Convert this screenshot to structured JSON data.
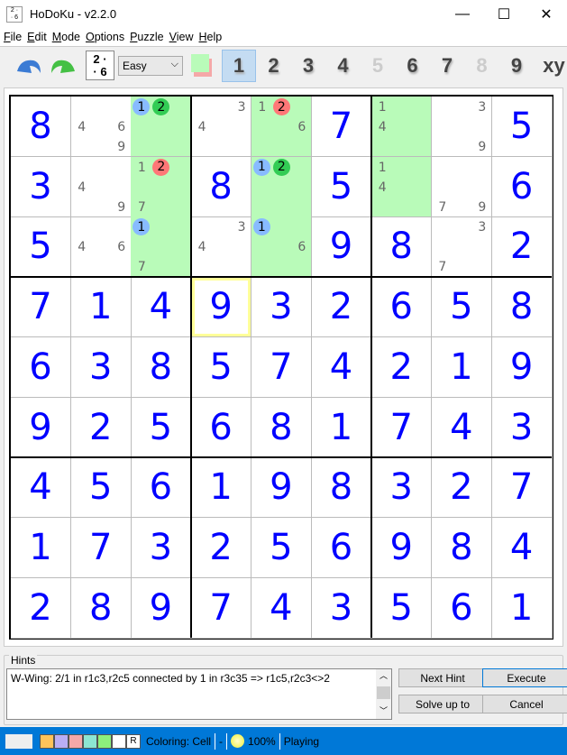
{
  "window": {
    "title": "HoDoKu - v2.2.0",
    "minimize": "—",
    "maximize": "☐",
    "close": "✕"
  },
  "menu": [
    {
      "label": "File",
      "u": "F",
      "rest": "ile"
    },
    {
      "label": "Edit",
      "u": "E",
      "rest": "dit"
    },
    {
      "label": "Mode",
      "u": "M",
      "rest": "ode"
    },
    {
      "label": "Options",
      "u": "O",
      "rest": "ptions"
    },
    {
      "label": "Puzzle",
      "u": "P",
      "rest": "uzzle"
    },
    {
      "label": "View",
      "u": "V",
      "rest": "iew"
    },
    {
      "label": "Help",
      "u": "H",
      "rest": "elp"
    }
  ],
  "toolbar": {
    "level": "Easy",
    "numbers": [
      {
        "d": "1",
        "state": "active"
      },
      {
        "d": "2",
        "state": "normal"
      },
      {
        "d": "3",
        "state": "normal"
      },
      {
        "d": "4",
        "state": "normal"
      },
      {
        "d": "5",
        "state": "dim"
      },
      {
        "d": "6",
        "state": "normal"
      },
      {
        "d": "7",
        "state": "normal"
      },
      {
        "d": "8",
        "state": "dim"
      },
      {
        "d": "9",
        "state": "normal"
      }
    ],
    "xy": "xy"
  },
  "colors": {
    "given": "#0000ff",
    "cellHighlight": "#b9fbb9",
    "blue": "#88bbff",
    "green": "#33cc55",
    "red": "#ff7777",
    "selected": "#ffff99",
    "statusbar": "#0078d7"
  },
  "grid": {
    "selected": [
      3,
      3
    ],
    "rows": [
      [
        {
          "v": "8"
        },
        {
          "c": [
            4,
            6,
            9
          ]
        },
        {
          "g": 1,
          "c": [
            {
              "d": 1,
              "m": "blue"
            },
            {
              "d": 2,
              "m": "green"
            }
          ]
        },
        {
          "c": [
            3,
            4
          ]
        },
        {
          "g": 1,
          "c": [
            1,
            {
              "d": 2,
              "m": "red"
            },
            6
          ]
        },
        {
          "v": "7"
        },
        {
          "g": 1,
          "c": [
            1,
            4
          ]
        },
        {
          "c": [
            3,
            9
          ]
        },
        {
          "v": "5"
        }
      ],
      [
        {
          "v": "3"
        },
        {
          "c": [
            4,
            9
          ]
        },
        {
          "g": 1,
          "c": [
            1,
            {
              "d": 2,
              "m": "red"
            },
            7
          ]
        },
        {
          "v": "8"
        },
        {
          "g": 1,
          "c": [
            {
              "d": 1,
              "m": "blue"
            },
            {
              "d": 2,
              "m": "green"
            }
          ]
        },
        {
          "v": "5"
        },
        {
          "g": 1,
          "c": [
            1,
            4
          ]
        },
        {
          "c": [
            7,
            9
          ]
        },
        {
          "v": "6"
        }
      ],
      [
        {
          "v": "5"
        },
        {
          "c": [
            4,
            6
          ]
        },
        {
          "g": 1,
          "c": [
            {
              "d": 1,
              "m": "blue"
            },
            7
          ]
        },
        {
          "c": [
            3,
            4
          ]
        },
        {
          "g": 1,
          "c": [
            {
              "d": 1,
              "m": "blue"
            },
            6
          ]
        },
        {
          "v": "9"
        },
        {
          "v": "8"
        },
        {
          "c": [
            3,
            7
          ]
        },
        {
          "v": "2"
        }
      ],
      [
        {
          "v": "7"
        },
        {
          "v": "1"
        },
        {
          "v": "4"
        },
        {
          "v": "9"
        },
        {
          "v": "3"
        },
        {
          "v": "2"
        },
        {
          "v": "6"
        },
        {
          "v": "5"
        },
        {
          "v": "8"
        }
      ],
      [
        {
          "v": "6"
        },
        {
          "v": "3"
        },
        {
          "v": "8"
        },
        {
          "v": "5"
        },
        {
          "v": "7"
        },
        {
          "v": "4"
        },
        {
          "v": "2"
        },
        {
          "v": "1"
        },
        {
          "v": "9"
        }
      ],
      [
        {
          "v": "9"
        },
        {
          "v": "2"
        },
        {
          "v": "5"
        },
        {
          "v": "6"
        },
        {
          "v": "8"
        },
        {
          "v": "1"
        },
        {
          "v": "7"
        },
        {
          "v": "4"
        },
        {
          "v": "3"
        }
      ],
      [
        {
          "v": "4"
        },
        {
          "v": "5"
        },
        {
          "v": "6"
        },
        {
          "v": "1"
        },
        {
          "v": "9"
        },
        {
          "v": "8"
        },
        {
          "v": "3"
        },
        {
          "v": "2"
        },
        {
          "v": "7"
        }
      ],
      [
        {
          "v": "1"
        },
        {
          "v": "7"
        },
        {
          "v": "3"
        },
        {
          "v": "2"
        },
        {
          "v": "5"
        },
        {
          "v": "6"
        },
        {
          "v": "9"
        },
        {
          "v": "8"
        },
        {
          "v": "4"
        }
      ],
      [
        {
          "v": "2"
        },
        {
          "v": "8"
        },
        {
          "v": "9"
        },
        {
          "v": "7"
        },
        {
          "v": "4"
        },
        {
          "v": "3"
        },
        {
          "v": "5"
        },
        {
          "v": "6"
        },
        {
          "v": "1"
        }
      ]
    ]
  },
  "hints": {
    "label": "Hints",
    "text": "W-Wing: 2/1 in r1c3,r2c5 connected by 1 in r3c35 => r1c5,r2c3<>2",
    "next_hint": "Next Hint",
    "execute": "Execute",
    "solve_up_to": "Solve up to",
    "cancel": "Cancel"
  },
  "status": {
    "swatches": [
      "#ffc35a",
      "#b9aef5",
      "#f5a8a8",
      "#8ce6d2",
      "#8cf07c",
      "#ffffff"
    ],
    "reset": "R",
    "coloring": "Coloring: Cell",
    "dash": "-",
    "progress": "100%",
    "state": "Playing"
  }
}
